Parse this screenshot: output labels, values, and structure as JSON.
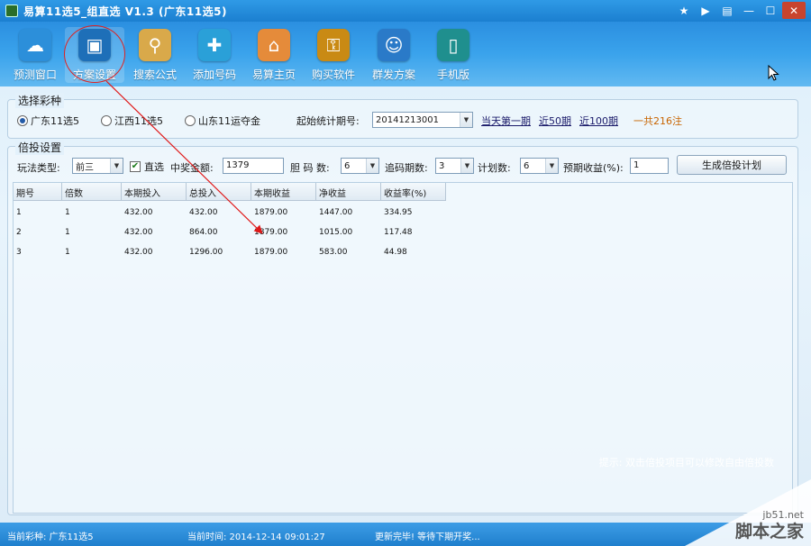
{
  "window": {
    "title": "易算11选5_组直选  V1.3 (广东11选5)",
    "controls": [
      "★",
      "▶",
      "▤",
      "—",
      "☐",
      "✕"
    ]
  },
  "toolbar": {
    "items": [
      {
        "label": "预测窗口",
        "icon": "cloud-icon",
        "color": "#2c8fda"
      },
      {
        "label": "方案设置",
        "icon": "monitor-settings-icon",
        "color": "#1e6fb8"
      },
      {
        "label": "搜索公式",
        "icon": "search-document-icon",
        "color": "#d9a94a"
      },
      {
        "label": "添加号码",
        "icon": "add-folder-icon",
        "color": "#2aa0d8"
      },
      {
        "label": "易算主页",
        "icon": "home-icon",
        "color": "#e58b3a"
      },
      {
        "label": "购买软件",
        "icon": "key-icon",
        "color": "#c98a14"
      },
      {
        "label": "群发方案",
        "icon": "group-icon",
        "color": "#2a7ac8"
      },
      {
        "label": "手机版",
        "icon": "mobile-icon",
        "color": "#1f8f8e"
      }
    ]
  },
  "lottery": {
    "group_title": "选择彩种",
    "options": [
      {
        "label": "广东11选5",
        "selected": true
      },
      {
        "label": "江西11选5",
        "selected": false
      },
      {
        "label": "山东11运夺金",
        "selected": false
      }
    ],
    "start_label": "起始统计期号:",
    "start_value": "20141213001",
    "links": [
      "当天第一期",
      "近50期",
      "近100期"
    ],
    "total_text": "一共216注"
  },
  "bet": {
    "group_title": "倍投设置",
    "play_type_label": "玩法类型:",
    "play_type_value": "前三",
    "direct_label": "直选",
    "direct_checked": true,
    "prize_label": "中奖金额:",
    "prize_value": "1379",
    "bet_count_label": "胆 码 数:",
    "bet_count_value": "6",
    "chase_label": "追码期数:",
    "chase_value": "3",
    "plan_label": "计划数:",
    "plan_value": "6",
    "expected_label": "预期收益(%):",
    "expected_value": "1",
    "generate_button": "生成倍投计划"
  },
  "table": {
    "headers": [
      "期号",
      "倍数",
      "本期投入",
      "总投入",
      "本期收益",
      "净收益",
      "收益率(%)"
    ],
    "rows": [
      [
        "1",
        "1",
        "432.00",
        "432.00",
        "1879.00",
        "1447.00",
        "334.95"
      ],
      [
        "2",
        "1",
        "432.00",
        "864.00",
        "1879.00",
        "1015.00",
        "117.48"
      ],
      [
        "3",
        "1",
        "432.00",
        "1296.00",
        "1879.00",
        "583.00",
        "44.98"
      ]
    ]
  },
  "hint": "提示: 双击倍投项目可以修改自由倍投数",
  "status": {
    "current_lottery": "当前彩种: 广东11选5",
    "current_time": "当前时间: 2014-12-14  09:01:27",
    "update_msg": "更新完毕! 等待下期开奖..."
  },
  "watermark": {
    "domain": "jb51.net",
    "name": "脚本之家"
  }
}
